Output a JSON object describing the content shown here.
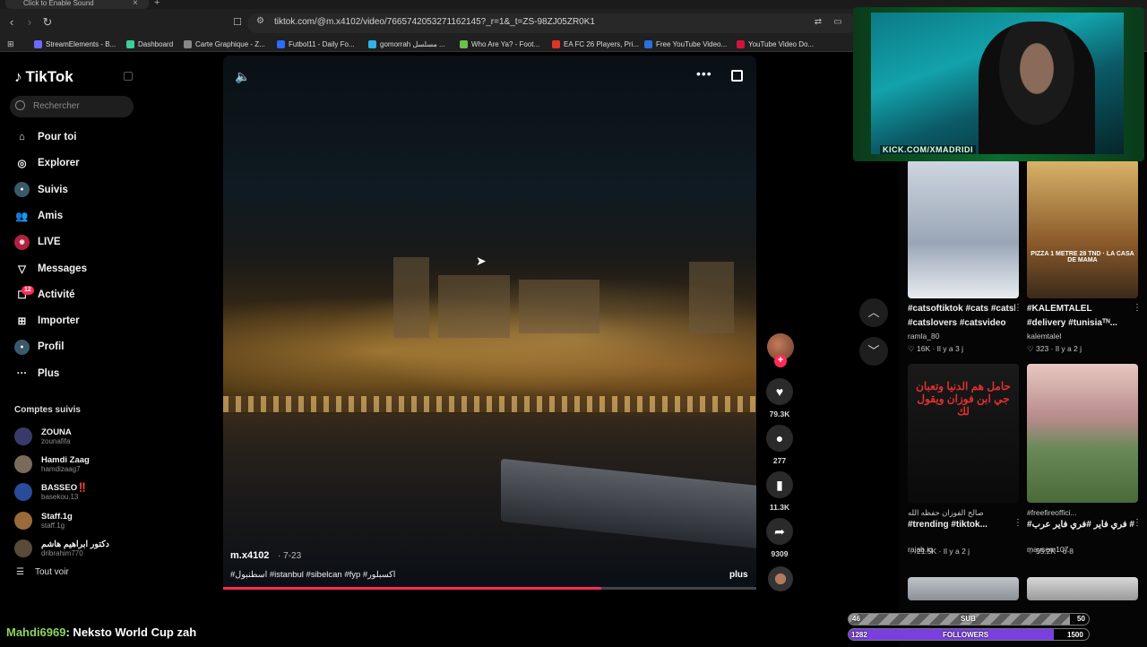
{
  "browser": {
    "tab_title": "Click to Enable Sound",
    "url": "tiktok.com/@m.x4102/video/7665742053271162145?_r=1&_t=ZS-98ZJ05ZR0K1",
    "bookmarks": [
      {
        "label": "StreamElements - B...",
        "color": "#6b6bff"
      },
      {
        "label": "Dashboard",
        "color": "#3ccf9a"
      },
      {
        "label": "Carte Graphique - Z...",
        "color": "#888888"
      },
      {
        "label": "Futbol11 - Daily Fo...",
        "color": "#2b6bff"
      },
      {
        "label": "gomorrah مسلسل ...",
        "color": "#31b4e8"
      },
      {
        "label": "Who Are Ya? - Foot...",
        "color": "#6ac04a"
      },
      {
        "label": "EA FC 26 Players, Pri...",
        "color": "#e0342b"
      },
      {
        "label": "Free YouTube Video...",
        "color": "#2a6fdb"
      },
      {
        "label": "YouTube Video Do...",
        "color": "#d3143a"
      }
    ]
  },
  "sidebar": {
    "logo": "TikTok",
    "search_placeholder": "Rechercher",
    "nav": [
      {
        "label": "Pour toi",
        "icon": "home-icon"
      },
      {
        "label": "Explorer",
        "icon": "compass-icon"
      },
      {
        "label": "Suivis",
        "icon": "following-icon"
      },
      {
        "label": "Amis",
        "icon": "friends-icon"
      },
      {
        "label": "LIVE",
        "icon": "live-icon"
      },
      {
        "label": "Messages",
        "icon": "messages-icon"
      },
      {
        "label": "Activité",
        "icon": "activity-icon"
      },
      {
        "label": "Importer",
        "icon": "upload-icon"
      },
      {
        "label": "Profil",
        "icon": "profile-icon"
      },
      {
        "label": "Plus",
        "icon": "more-icon"
      }
    ],
    "activity_badge": "12",
    "following_title": "Comptes suivis",
    "accounts": [
      {
        "name": "ZOUNA",
        "handle": "zounafifa",
        "color": "#3a3a6a"
      },
      {
        "name": "Hamdi Zaag",
        "handle": "hamdizaag7",
        "color": "#7a6a5a"
      },
      {
        "name": "BASSEO‼️",
        "handle": "basekou.13",
        "color": "#2a4a9a"
      },
      {
        "name": "Staff.1g",
        "handle": "staff.1g",
        "color": "#9a6a3a"
      },
      {
        "name": "دكتور ابراهيم هاشم",
        "handle": "dribrahim770",
        "color": "#5a4a3a"
      }
    ],
    "see_all": "Tout voir"
  },
  "video": {
    "author": "m.x4102",
    "date": "7-23",
    "caption": "#اسطنبول #istanbul #sibelcan #fyp #اكسبلور",
    "more": "plus",
    "progress": 0.71,
    "likes": "79.3K",
    "comments": "277",
    "saves": "11.3K",
    "shares": "9309"
  },
  "grid": [
    {
      "title": "#catsoftiktok #cats #catslovers #catsvideo",
      "title2": "#catslovers #catsvideo",
      "user": "ramla_80",
      "meta": "16K · Il y a 3 j",
      "thumb": "linear-gradient(180deg,#cfd6e0,#9aa6b6 60%,#e8ecf0)"
    },
    {
      "title": "#KALEMTALEL",
      "title2": "#delivery #tunisiaᵀᴺ...",
      "user": "kalemtalel",
      "meta": "323 · Il y a 2 j",
      "thumb": "linear-gradient(180deg,#d9b46a,#8a5a2a 60%,#3a2a1a)",
      "overlay": "PIZZA 1 METRE 28 TND · LA CASA DE MAMA"
    },
    {
      "title": "#trending #tiktok...",
      "title2": "صالح الفوزان حفظه الله",
      "user": "rajab.iq",
      "meta": "21.5K · Il y a 2 j",
      "thumb": "linear-gradient(180deg,#1a1a1a,#0a0a0a)",
      "overlay": "حامل هم الدنيا وتعبان\nجي ابن فوزان ويقول لك"
    },
    {
      "title": "#فري فاير #فري فاير عرب #...",
      "title2": "#freefireoffici...",
      "user": "maysem107",
      "meta": "55.2K · 6-8",
      "thumb": "linear-gradient(180deg,#e8c8c0,#b58a8a 40%,#6a8a5a 60%,#4a6a3a)"
    }
  ],
  "overlay": {
    "cam_label": "KICK.COM/XMADRIDI",
    "chat_user": "Mahdi6969",
    "chat_message": ": Neksto World Cup zah",
    "sub_goal": {
      "label": "SUB",
      "current": "46",
      "target": "50"
    },
    "follower_goal": {
      "label": "FOLLOWERS",
      "current": "1282",
      "target": "1500"
    }
  }
}
